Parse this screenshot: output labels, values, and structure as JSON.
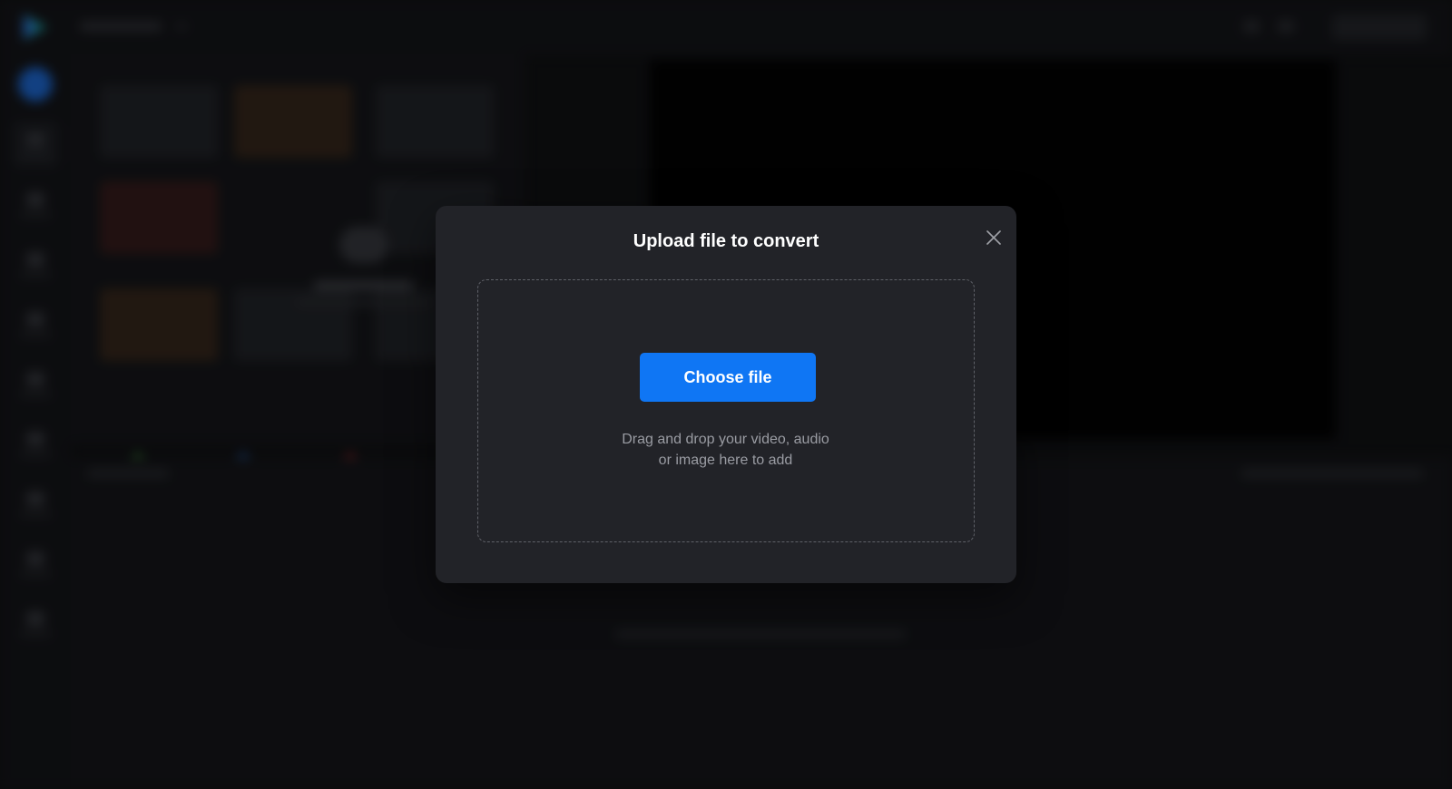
{
  "dialog": {
    "title": "Upload file to convert",
    "choose_file_label": "Choose file",
    "drop_hint_line1": "Drag and drop your video, audio",
    "drop_hint_line2": "or image here to add",
    "close_icon": "close-icon"
  },
  "colors": {
    "accent": "#0f76f4",
    "dialog_bg": "#222328",
    "page_bg": "#121316"
  }
}
